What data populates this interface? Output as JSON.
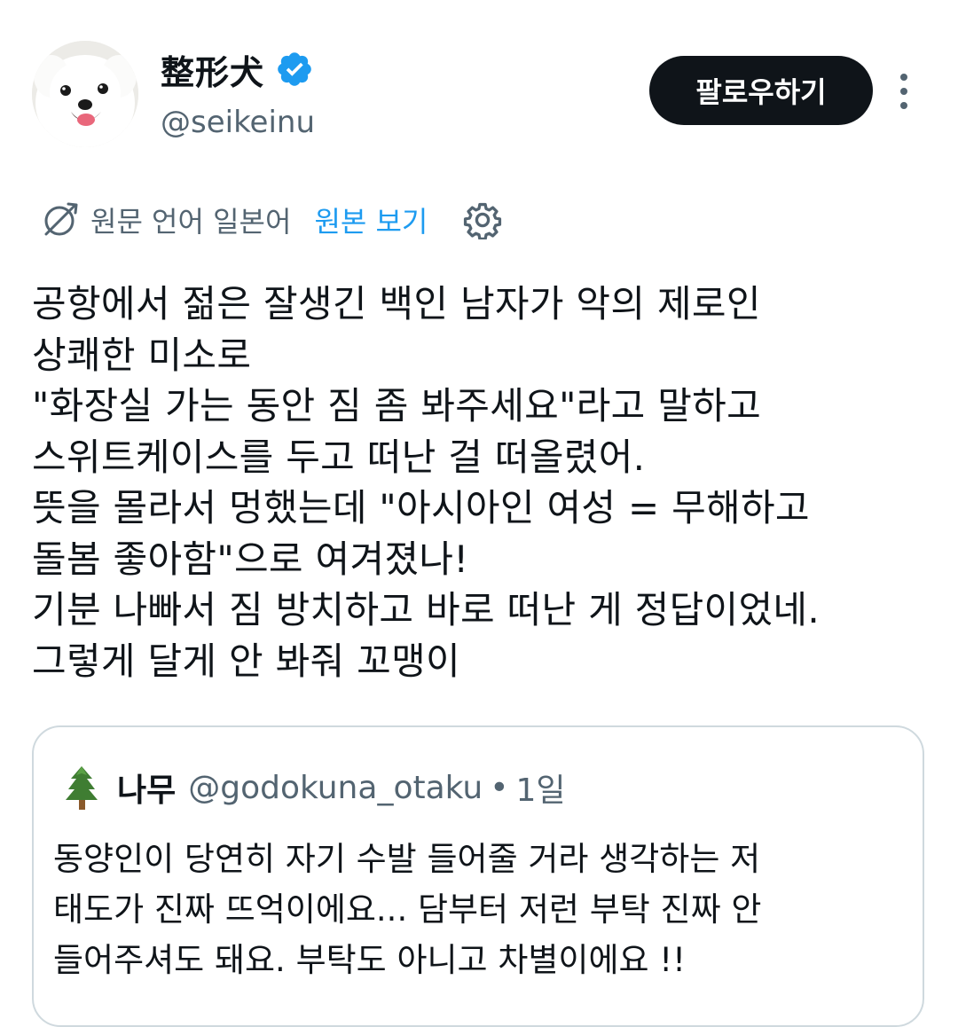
{
  "author": {
    "display_name": "整形犬",
    "handle": "@seikeinu"
  },
  "actions": {
    "follow_label": "팔로우하기"
  },
  "translation": {
    "source_language_label": "원문 언어 일본어",
    "view_original_label": "원본 보기"
  },
  "tweet": {
    "lines": [
      "공항에서 젊은 잘생긴 백인 남자가 악의 제로인",
      "상쾌한 미소로",
      "\"화장실 가는 동안 짐 좀 봐주세요\"라고 말하고",
      "스위트케이스를 두고 떠난 걸 떠올렸어.",
      "뜻을 몰라서 멍했는데 \"아시아인 여성 = 무해하고",
      "돌봄 좋아함\"으로 여겨졌나!",
      "기분 나빠서 짐 방치하고 바로 떠난 게 정답이었네.",
      "그렇게 달게 안 봐줘 꼬맹이"
    ]
  },
  "quote": {
    "name": "나무",
    "handle": "@godokuna_otaku",
    "separator": "•",
    "time": "1일",
    "lines": [
      "동양인이 당연히 자기 수발 들어줄 거라 생각하는 저",
      "태도가 진짜 뜨억이에요... 담부터 저런 부탁 진짜 안",
      "들어주셔도 돼요. 부탁도 아니고 차별이에요 !!"
    ]
  },
  "icons": {
    "verified": "verified-badge-icon",
    "more": "more-vertical-icon",
    "translate": "translate-icon",
    "settings": "gear-icon",
    "quote_avatar": "tree-icon"
  },
  "colors": {
    "text_primary": "#0f1419",
    "text_secondary": "#536471",
    "accent_blue": "#1d9bf0",
    "follow_button_bg": "#0f1419",
    "border": "#cfd9de"
  }
}
